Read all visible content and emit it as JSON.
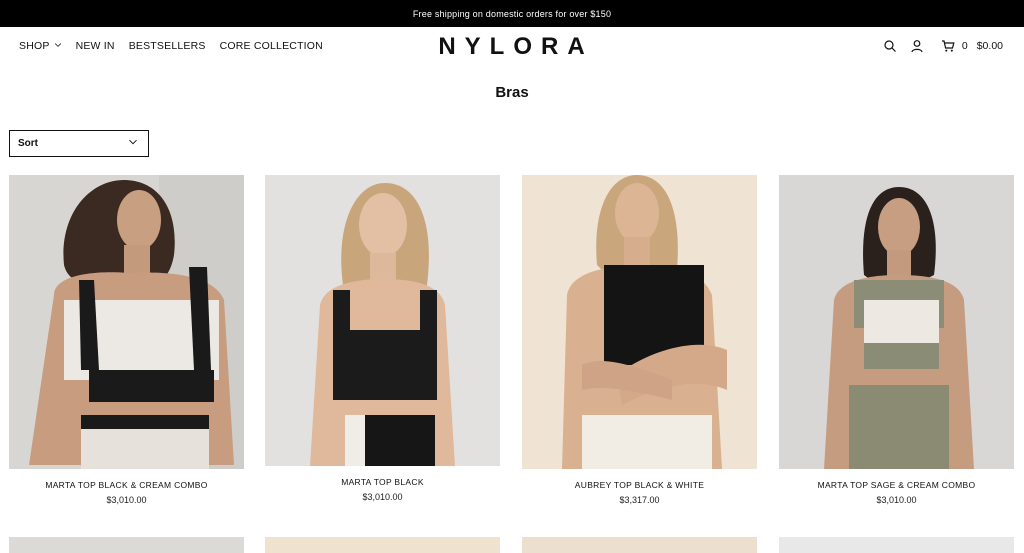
{
  "announcement": "Free shipping on domestic orders for over $150",
  "nav": [
    {
      "label": "SHOP",
      "has_dropdown": true
    },
    {
      "label": "NEW IN"
    },
    {
      "label": "BESTSELLERS"
    },
    {
      "label": "CORE COLLECTION"
    }
  ],
  "logo": "NYLORA",
  "cart": {
    "count": "0",
    "total": "$0.00"
  },
  "page_title": "Bras",
  "sort": {
    "label": "Sort"
  },
  "products": [
    {
      "name": "MARTA TOP BLACK & CREAM COMBO",
      "price": "$3,010.00"
    },
    {
      "name": "MARTA TOP BLACK",
      "price": "$3,010.00"
    },
    {
      "name": "AUBREY TOP BLACK & WHITE",
      "price": "$3,317.00"
    },
    {
      "name": "MARTA TOP SAGE & CREAM COMBO",
      "price": "$3,010.00"
    }
  ],
  "colors": {
    "announcement_bg": "#000000",
    "text": "#111111",
    "background": "#ffffff"
  },
  "icons": [
    "chevron-down-icon",
    "search-icon",
    "user-icon",
    "cart-icon"
  ]
}
